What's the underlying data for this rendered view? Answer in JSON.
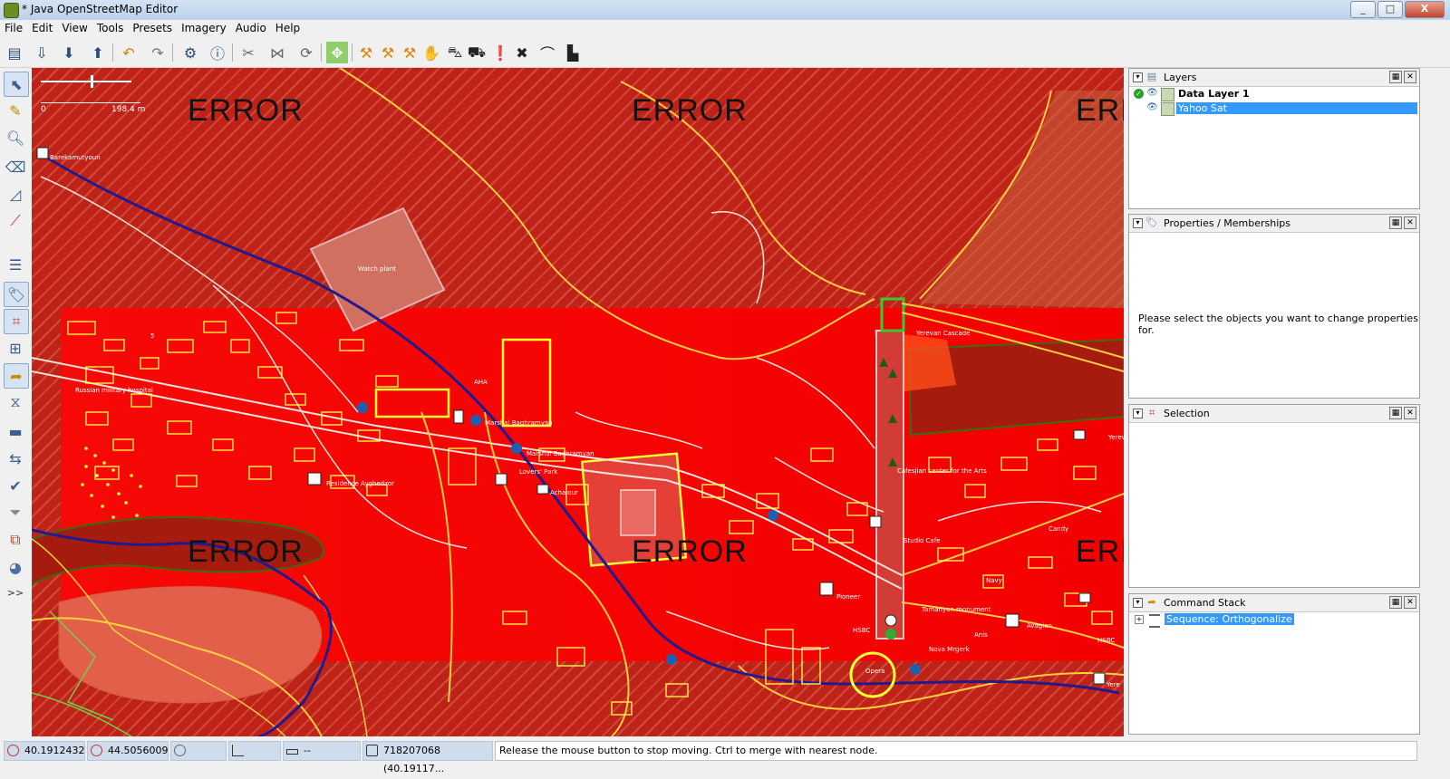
{
  "window": {
    "title": "* Java OpenStreetMap Editor",
    "buttons": {
      "minimize": "_",
      "maximize": "□",
      "close": "X"
    }
  },
  "menu": [
    "File",
    "Edit",
    "View",
    "Tools",
    "Presets",
    "Imagery",
    "Audio",
    "Help"
  ],
  "toolbar": {
    "icons": [
      "open-icon",
      "download-icon",
      "download-area-icon",
      "upload-icon",
      "undo-icon",
      "redo-icon",
      "preferences-icon",
      "info-icon",
      "split-way-icon",
      "combine-way-icon",
      "refresh-icon",
      "zoom-data-icon",
      "highway-icon",
      "highway-link-icon",
      "path-icon",
      "hand-icon",
      "car-icon",
      "bus-icon",
      "warning-icon",
      "close-x-icon",
      "bridge-icon",
      "chart-icon"
    ]
  },
  "left_tools": [
    "select-tool-icon",
    "draw-tool-icon",
    "zoom-tool-icon",
    "delete-tool-icon",
    "measure-tool-icon",
    "path-tool-icon",
    "layers-toggle-icon",
    "properties-toggle-icon",
    "selection-toggle-icon",
    "relations-toggle-icon",
    "validator-toggle-icon",
    "history-toggle-icon",
    "conflict-toggle-icon",
    "changeset-toggle-icon",
    "validate-icon",
    "filter-icon",
    "toolbox-icon",
    "palette-icon"
  ],
  "left_tools_more": ">>",
  "map": {
    "scale_start": "0",
    "scale_end": "198.4 m",
    "error_text": "ERROR",
    "labels": {
      "bus_stop": "Barekamutyoun",
      "watch_plant": "Watch plant",
      "hospital": "Russian military hospital",
      "street_5": "5",
      "residence": "Residence Ayghedzor",
      "park": "Lovers' Park",
      "achajour": "Achajour",
      "bagramyan": "Marshal Baghramyan",
      "bagramyan2": "Marshal Baghramyan",
      "ahaa": "AHA",
      "cafesjian": "Cafesjian center for the Arts",
      "studio_cafe": "Studio Cafe",
      "pioneer": "Pioneer",
      "hsbc": "HSBC",
      "hsbc2": "HSBC",
      "tamanyan": "Tamanyan monument",
      "yerevan": "Yerev",
      "candy": "Candy",
      "navy": "Navy",
      "avagian": "Avagian",
      "nova": "Nova Mrgerk",
      "ani": "Anis",
      "yere2": "Yere",
      "opera": "Opera",
      "cascade": "Yerevan Cascade"
    }
  },
  "panels": {
    "layers": {
      "title": "Layers",
      "items": [
        {
          "name": "Data Layer 1",
          "bold": true,
          "active": true
        },
        {
          "name": "Yahoo Sat",
          "selected": true
        }
      ]
    },
    "properties": {
      "title": "Properties / Memberships",
      "message": "Please select the objects you want to change properties for."
    },
    "selection": {
      "title": "Selection"
    },
    "command_stack": {
      "title": "Command Stack",
      "items": [
        "Sequence: Orthogonalize"
      ]
    }
  },
  "statusbar": {
    "lat": "40.1912432",
    "lon": "44.5056009",
    "heading": "",
    "angle": "",
    "distance": "--",
    "node": "718207068 (40.19117...",
    "message": "Release the mouse button to stop moving. Ctrl to merge with nearest node."
  }
}
